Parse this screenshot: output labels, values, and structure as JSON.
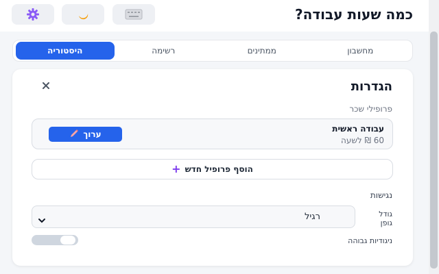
{
  "header": {
    "title": "כמה שעות עבודה?",
    "buttons": [
      {
        "icon": "keyboard-icon"
      },
      {
        "icon": "moon-icon"
      },
      {
        "icon": "gear-icon"
      }
    ]
  },
  "tabs": [
    {
      "label": "מחשבון",
      "active": false
    },
    {
      "label": "ממתינים",
      "active": false
    },
    {
      "label": "רשימה",
      "active": false
    },
    {
      "label": "היסטוריה",
      "active": true
    }
  ],
  "settings": {
    "title": "הגדרות",
    "close_icon": "close-icon",
    "salary_profiles_label": "פרופילי שכר",
    "profile": {
      "name": "עבודה ראשית",
      "rate": "60 ₪ לשעה",
      "edit_label": "ערוך",
      "edit_icon": "pencil-icon"
    },
    "add_profile_label": "הוסף פרופיל חדש",
    "add_icon": "plus-icon",
    "accessibility_label": "נגישות",
    "font_size_label": "גודל גופן",
    "font_size_value": "רגיל",
    "high_contrast_label": "ניגודיות גבוהה",
    "high_contrast_enabled": false
  },
  "colors": {
    "accent": "#2563eb",
    "plus": "#7c3aed",
    "moon": "#f59e0b",
    "gear": "#8b5cf6"
  }
}
